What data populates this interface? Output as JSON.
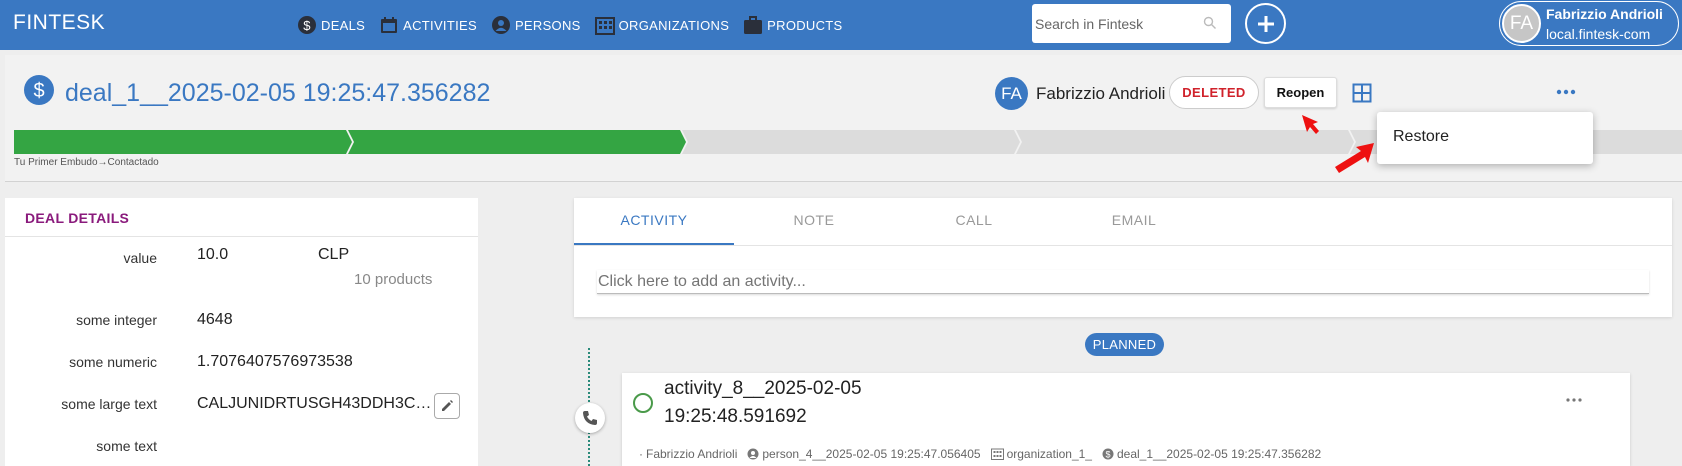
{
  "topbar": {
    "brand": "FINTESK",
    "nav": [
      {
        "label": "DEALS",
        "icon": "dollar-icon"
      },
      {
        "label": "ACTIVITIES",
        "icon": "calendar-icon"
      },
      {
        "label": "PERSONS",
        "icon": "person-icon"
      },
      {
        "label": "ORGANIZATIONS",
        "icon": "building-icon"
      },
      {
        "label": "PRODUCTS",
        "icon": "briefcase-icon"
      }
    ],
    "search_placeholder": "Search in Fintesk",
    "user": {
      "initials": "FA",
      "name": "Fabrizzio Andrioli",
      "domain": "local.fintesk-com"
    }
  },
  "deal": {
    "title": "deal_1__2025-02-05 19:25:47.356282",
    "owner_initials": "FA",
    "owner_name": "Fabrizzio Andrioli",
    "status_badge": "DELETED",
    "reopen_label": "Reopen",
    "pipeline_label": "Tu Primer Embudo",
    "stage_label": "Contactado",
    "pipeline": {
      "total_stages": 5,
      "completed_stages": 2
    },
    "menu": {
      "items": [
        "Restore"
      ]
    }
  },
  "details": {
    "title": "DEAL DETAILS",
    "rows": [
      {
        "label": "value",
        "value": "10.0",
        "currency": "CLP",
        "sub": "10 products"
      },
      {
        "label": "some integer",
        "value": "4648"
      },
      {
        "label": "some numeric",
        "value": "1.7076407576973538"
      },
      {
        "label": "some large text",
        "value": "CALJUNIDRTUSGH43DDH3C…"
      },
      {
        "label": "some text",
        "value": ""
      }
    ]
  },
  "activity_panel": {
    "tabs": [
      "ACTIVITY",
      "NOTE",
      "CALL",
      "EMAIL"
    ],
    "active_tab": "ACTIVITY",
    "add_placeholder": "Click here to add an activity...",
    "group_badge": "PLANNED",
    "item": {
      "title_line1": "activity_8__2025-02-05",
      "title_line2": "19:25:48.591692",
      "owner": "Fabrizzio Andrioli",
      "person": "person_4__2025-02-05 19:25:47.056405",
      "organization": "organization_1_",
      "deal": "deal_1__2025-02-05 19:25:47.356282"
    }
  },
  "colors": {
    "primary": "#3a78c2",
    "success": "#34a543",
    "danger": "#d0222b",
    "accent_purple": "#8a1a7c",
    "annotation_red": "#ee1111"
  }
}
